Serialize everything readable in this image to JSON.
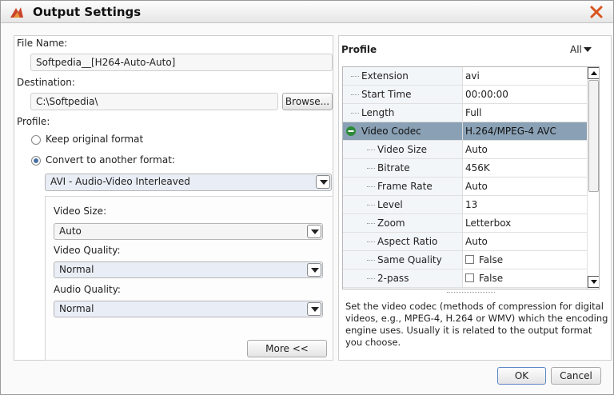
{
  "window": {
    "title": "Output Settings"
  },
  "left": {
    "file_name_label": "File Name:",
    "file_name_value": "Softpedia__[H264-Auto-Auto]",
    "destination_label": "Destination:",
    "destination_value": "C:\\Softpedia\\",
    "browse_label": "Browse...",
    "profile_label": "Profile:",
    "keep_original_label": "Keep original format",
    "convert_label": "Convert to another format:",
    "format_value": "AVI - Audio-Video Interleaved",
    "video_size_label": "Video Size:",
    "video_size_value": "Auto",
    "video_quality_label": "Video Quality:",
    "video_quality_value": "Normal",
    "audio_quality_label": "Audio Quality:",
    "audio_quality_value": "Normal",
    "more_label": "More <<"
  },
  "right": {
    "profile_title": "Profile",
    "filter_value": "All",
    "rows": [
      {
        "key": "Extension",
        "value": "avi"
      },
      {
        "key": "Start Time",
        "value": "00:00:00"
      },
      {
        "key": "Length",
        "value": "Full"
      },
      {
        "key": "Video Codec",
        "value": "H.264/MPEG-4 AVC"
      },
      {
        "key": "Video Size",
        "value": "Auto"
      },
      {
        "key": "Bitrate",
        "value": "456K"
      },
      {
        "key": "Frame Rate",
        "value": "Auto"
      },
      {
        "key": "Level",
        "value": "13"
      },
      {
        "key": "Zoom",
        "value": "Letterbox"
      },
      {
        "key": "Aspect Ratio",
        "value": "Auto"
      },
      {
        "key": "Same Quality",
        "value": "False"
      },
      {
        "key": "2-pass",
        "value": "False"
      }
    ],
    "description": "Set the video codec (methods of compression for digital videos, e.g., MPEG-4, H.264 or WMV) which the encoding engine uses. Usually it is related to the output format you choose."
  },
  "footer": {
    "ok_label": "OK",
    "cancel_label": "Cancel"
  },
  "colors": {
    "accent": "#8aa1b5",
    "collapse_icon": "#2e8b3a",
    "close_icon": "#d9541e"
  },
  "icons": [
    "app-icon",
    "close-icon",
    "collapse-icon",
    "chevron-down-icon",
    "scroll-up-icon",
    "scroll-down-icon"
  ]
}
